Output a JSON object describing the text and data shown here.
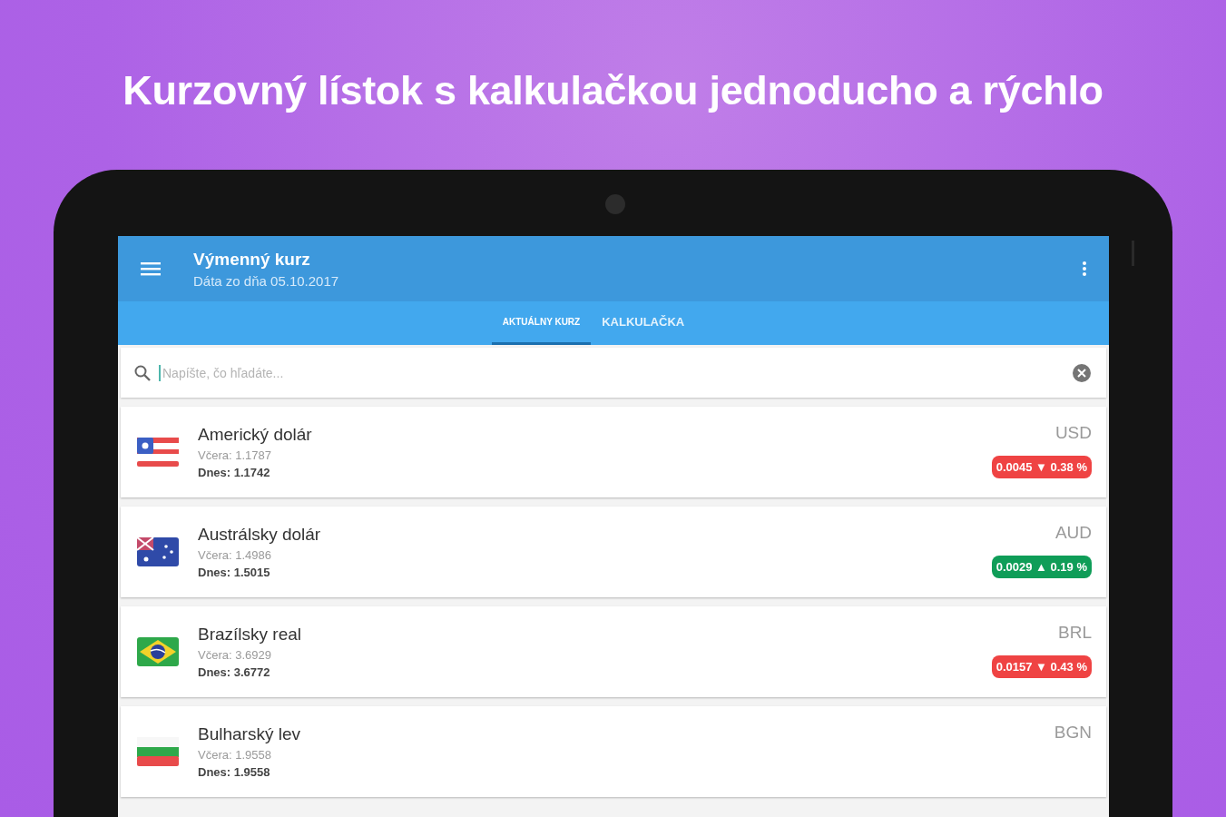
{
  "headline": "Kurzovný lístok s kalkulačkou jednoducho a rýchlo",
  "app_bar": {
    "title": "Výmenný kurz",
    "subtitle": "Dáta zo dňa 05.10.2017"
  },
  "tabs": [
    {
      "label": "AKTUÁLNY KURZ",
      "selected": true
    },
    {
      "label": "KALKULAČKA",
      "selected": false
    }
  ],
  "search": {
    "placeholder": "Napíšte, čo hľadáte..."
  },
  "currencies": [
    {
      "kind": "us",
      "name": "Americký dolár",
      "yesterday": "Včera: 1.1787",
      "today": "Dnes: 1.1742",
      "code": "USD",
      "change": "0.0045 ▼ 0.38 %",
      "color": "#ef4343"
    },
    {
      "kind": "au",
      "name": "Austrálsky dolár",
      "yesterday": "Včera: 1.4986",
      "today": "Dnes: 1.5015",
      "code": "AUD",
      "change": "0.0029 ▲ 0.19 %",
      "color": "#0f9d58"
    },
    {
      "kind": "br",
      "name": "Brazílsky real",
      "yesterday": "Včera: 3.6929",
      "today": "Dnes: 3.6772",
      "code": "BRL",
      "change": "0.0157 ▼ 0.43 %",
      "color": "#ef4343"
    },
    {
      "kind": "bg",
      "name": "Bulharský lev",
      "yesterday": "Včera: 1.9558",
      "today": "Dnes: 1.9558",
      "code": "BGN"
    }
  ]
}
